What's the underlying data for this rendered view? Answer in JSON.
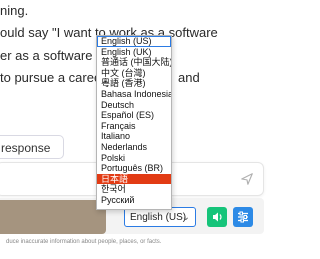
{
  "chat": {
    "line1": "ning.",
    "line2": "ould say \"I want to work as a software",
    "line3": "er as a software engi",
    "line4": "to pursue a career in t",
    "line4_end": "and"
  },
  "regenerate_label": "response",
  "disclaimer": "duce inaccurate information about people, places, or facts.",
  "language_select": {
    "value": "English (US)",
    "options": [
      "English (US)",
      "English (UK)",
      "普通话 (中国大陆)",
      "中文 (台灣)",
      "粵語 (香港)",
      "Bahasa Indonesia",
      "Deutsch",
      "Español (ES)",
      "Français",
      "Italiano",
      "Nederlands",
      "Polski",
      "Português (BR)",
      "日本語",
      "한국어",
      "Русский"
    ],
    "highlighted_option": "日本語"
  },
  "colors": {
    "accent_blue": "#2d8ae6",
    "speaker_green": "#16c47a",
    "highlight_red": "#e23b14"
  },
  "icons": {
    "send": "send-icon",
    "speaker": "speaker-icon",
    "settings": "settings-sliders-icon",
    "dropdown": "chevron-down-icon"
  }
}
